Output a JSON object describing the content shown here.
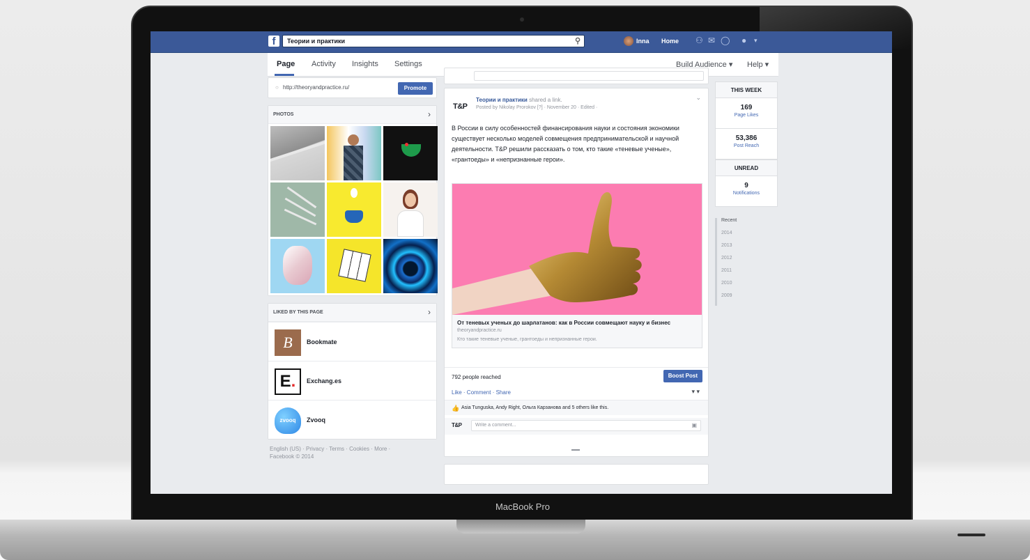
{
  "device": {
    "label": "MacBook Pro"
  },
  "topbar": {
    "search_value": "Теории и практики",
    "user_name": "Inna",
    "home_label": "Home"
  },
  "page_tabs": {
    "page": "Page",
    "activity": "Activity",
    "insights": "Insights",
    "settings": "Settings",
    "build_audience": "Build Audience ▾",
    "help": "Help ▾"
  },
  "left": {
    "url": "http://theoryandpractice.ru/",
    "promote": "Promote",
    "photos_header": "PHOTOS",
    "liked_header": "LIKED BY THIS PAGE",
    "liked": [
      {
        "name": "Bookmate"
      },
      {
        "name": "Exchang.es"
      },
      {
        "name": "Zvooq"
      }
    ],
    "footer_line1": "English (US) · Privacy · Terms · Cookies · More ·",
    "footer_line2": "Facebook © 2014"
  },
  "post": {
    "author_logo": "T&P",
    "author": "Теории и практики",
    "action": "shared a link.",
    "meta": "Posted by Nikolay Prorokov [?] · November 20 · Edited ·",
    "text": "В России в силу особенностей финансирования науки и состояния экономики существует несколько моделей совмещения предпринимательской и научной деятельности. T&P решили рассказать о том, кто такие «теневые ученые», «грантоеды» и «непризнанные герои».",
    "link_title": "От теневых ученых до шарлатанов: как в России совмещают науку и бизнес",
    "link_domain": "theoryandpractice.ru",
    "link_desc": "Кто такие теневые ученые, грантоеды и непризнанные герои.",
    "reached": "792 people reached",
    "boost": "Boost Post",
    "like": "Like",
    "comment": "Comment",
    "share": "Share",
    "likes_line": "Asia Tunguska, Andy Right, Ольга Карзанова and 5 others like this.",
    "comment_placeholder": "Write a comment...",
    "comment_logo": "T&P"
  },
  "right": {
    "this_week": "THIS WEEK",
    "page_likes_num": "169",
    "page_likes_lbl": "Page Likes",
    "post_reach_num": "53,386",
    "post_reach_lbl": "Post Reach",
    "unread": "UNREAD",
    "notifications_num": "9",
    "notifications_lbl": "Notifications",
    "timeline": [
      "Recent",
      "2014",
      "2013",
      "2012",
      "2011",
      "2010",
      "2009"
    ]
  },
  "colors": {
    "facebook_blue": "#3b5998",
    "button_blue": "#4267b2",
    "post_image_pink": "#fc7cb1"
  }
}
